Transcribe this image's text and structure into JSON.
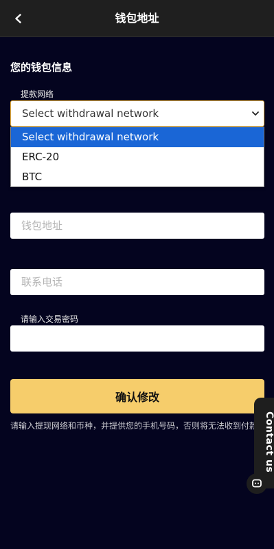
{
  "header": {
    "title": "钱包地址",
    "back_icon": "chevron-left-icon"
  },
  "form": {
    "section_title": "您的钱包信息",
    "network_label": "提款网络",
    "network_selected": "Select withdrawal network",
    "network_options": [
      "Select withdrawal network",
      "ERC-20",
      "BTC"
    ],
    "wallet_address_placeholder": "钱包地址",
    "phone_placeholder": "联系电话",
    "password_label": "请输入交易密码",
    "password_value": "",
    "submit_label": "确认修改",
    "hint": "请输入提现网络和币种，并提供您的手机号码，否则将无法收到付款"
  },
  "contact": {
    "label": "Contact us",
    "icon": "chat-icon"
  },
  "colors": {
    "background": "#04041f",
    "header": "#1f1f1f",
    "accent": "#f6cd6b",
    "selected_option": "#1a66d6"
  }
}
